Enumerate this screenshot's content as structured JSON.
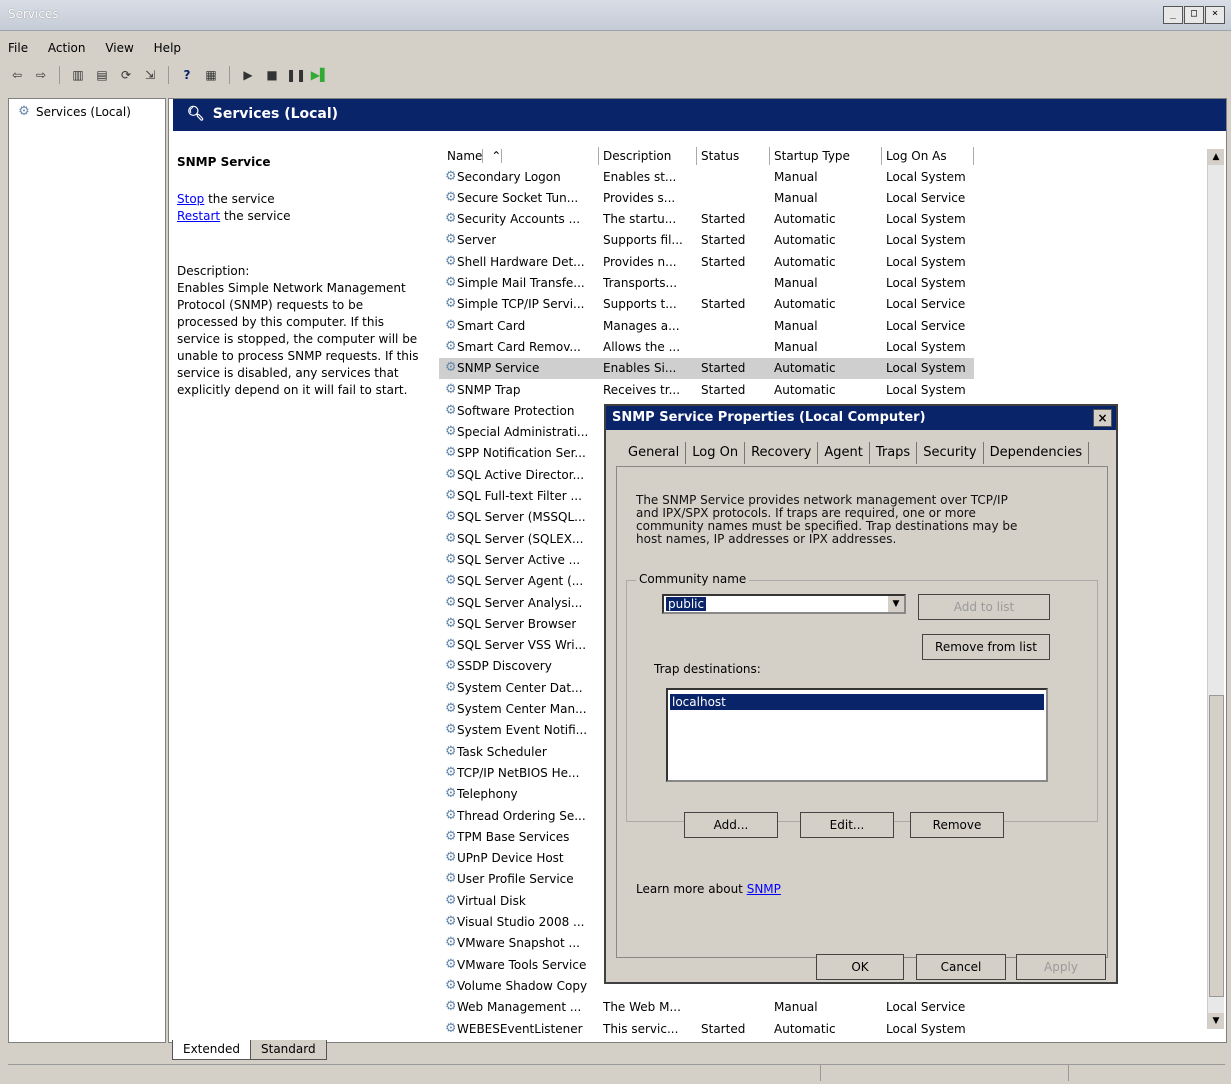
{
  "window": {
    "title": "Services"
  },
  "menu": [
    "File",
    "Action",
    "View",
    "Help"
  ],
  "tree": {
    "root": "Services (Local)"
  },
  "pane": {
    "header": "Services (Local)"
  },
  "details": {
    "service_name": "SNMP Service",
    "stop_link": "Stop",
    "stop_text": " the service",
    "restart_link": "Restart",
    "restart_text": " the service",
    "description_label": "Description:",
    "description": "Enables Simple Network Management Protocol (SNMP) requests to be processed by this computer. If this service is stopped, the computer will be unable to process SNMP requests. If this service is disabled, any services that explicitly depend on it will fail to start."
  },
  "columns": [
    "Name",
    "Description",
    "Status",
    "Startup Type",
    "Log On As"
  ],
  "rows": [
    [
      "Secondary Logon",
      "Enables st...",
      "",
      "Manual",
      "Local System"
    ],
    [
      "Secure Socket Tun...",
      "Provides s...",
      "",
      "Manual",
      "Local Service"
    ],
    [
      "Security Accounts ...",
      "The startu...",
      "Started",
      "Automatic",
      "Local System"
    ],
    [
      "Server",
      "Supports fil...",
      "Started",
      "Automatic",
      "Local System"
    ],
    [
      "Shell Hardware Det...",
      "Provides n...",
      "Started",
      "Automatic",
      "Local System"
    ],
    [
      "Simple Mail Transfe...",
      "Transports...",
      "",
      "Manual",
      "Local System"
    ],
    [
      "Simple TCP/IP Servi...",
      "Supports t...",
      "Started",
      "Automatic",
      "Local Service"
    ],
    [
      "Smart Card",
      "Manages a...",
      "",
      "Manual",
      "Local Service"
    ],
    [
      "Smart Card Remov...",
      "Allows the ...",
      "",
      "Manual",
      "Local System"
    ],
    [
      "SNMP Service",
      "Enables Si...",
      "Started",
      "Automatic",
      "Local System"
    ],
    [
      "SNMP Trap",
      "Receives tr...",
      "Started",
      "Automatic",
      "Local System"
    ],
    [
      "Software Protection",
      "",
      "",
      "",
      ""
    ],
    [
      "Special Administrati...",
      "",
      "",
      "",
      ""
    ],
    [
      "SPP Notification Ser...",
      "",
      "",
      "",
      ""
    ],
    [
      "SQL Active Director...",
      "",
      "",
      "",
      ""
    ],
    [
      "SQL Full-text Filter ...",
      "",
      "",
      "",
      ""
    ],
    [
      "SQL Server (MSSQL...",
      "",
      "",
      "",
      ""
    ],
    [
      "SQL Server (SQLEX...",
      "",
      "",
      "",
      ""
    ],
    [
      "SQL Server Active ...",
      "",
      "",
      "",
      ""
    ],
    [
      "SQL Server Agent (...",
      "",
      "",
      "",
      ""
    ],
    [
      "SQL Server Analysi...",
      "",
      "",
      "",
      ""
    ],
    [
      "SQL Server Browser",
      "",
      "",
      "",
      ""
    ],
    [
      "SQL Server VSS Wri...",
      "",
      "",
      "",
      ""
    ],
    [
      "SSDP Discovery",
      "",
      "",
      "",
      ""
    ],
    [
      "System Center Dat...",
      "",
      "",
      "",
      ""
    ],
    [
      "System Center Man...",
      "",
      "",
      "",
      ""
    ],
    [
      "System Event Notifi...",
      "",
      "",
      "",
      ""
    ],
    [
      "Task Scheduler",
      "",
      "",
      "",
      ""
    ],
    [
      "TCP/IP NetBIOS He...",
      "",
      "",
      "",
      ""
    ],
    [
      "Telephony",
      "",
      "",
      "",
      ""
    ],
    [
      "Thread Ordering Se...",
      "",
      "",
      "",
      ""
    ],
    [
      "TPM Base Services",
      "",
      "",
      "",
      ""
    ],
    [
      "UPnP Device Host",
      "",
      "",
      "",
      ""
    ],
    [
      "User Profile Service",
      "",
      "",
      "",
      ""
    ],
    [
      "Virtual Disk",
      "",
      "",
      "",
      ""
    ],
    [
      "Visual Studio 2008 ...",
      "",
      "",
      "",
      ""
    ],
    [
      "VMware Snapshot ...",
      "",
      "",
      "",
      ""
    ],
    [
      "VMware Tools Service",
      "",
      "",
      "",
      ""
    ],
    [
      "Volume Shadow Copy",
      "",
      "",
      "",
      ""
    ],
    [
      "Web Management ...",
      "The Web M...",
      "",
      "Manual",
      "Local Service"
    ],
    [
      "WEBESEventListener",
      "This servic...",
      "Started",
      "Automatic",
      "Local System"
    ]
  ],
  "selected_row": "SNMP Service",
  "bottom_tabs": [
    "Extended",
    "Standard"
  ],
  "dialog": {
    "title": "SNMP Service Properties (Local Computer)",
    "tabs": [
      "General",
      "Log On",
      "Recovery",
      "Agent",
      "Traps",
      "Security",
      "Dependencies"
    ],
    "active_tab": "Traps",
    "intro": "The SNMP Service provides network management over TCP/IP and IPX/SPX protocols. If traps are required, one or more community names must be specified. Trap destinations may be host names, IP addresses or IPX addresses.",
    "community_label": "Community name",
    "community_value": "public",
    "add_to_list": "Add to list",
    "remove_from_list": "Remove from list",
    "trap_destinations_label": "Trap destinations:",
    "trap_destinations": [
      "localhost"
    ],
    "add": "Add...",
    "edit": "Edit...",
    "remove": "Remove",
    "learn_more_text": "Learn more about ",
    "learn_more_link": "SNMP",
    "ok": "OK",
    "cancel": "Cancel",
    "apply": "Apply"
  }
}
